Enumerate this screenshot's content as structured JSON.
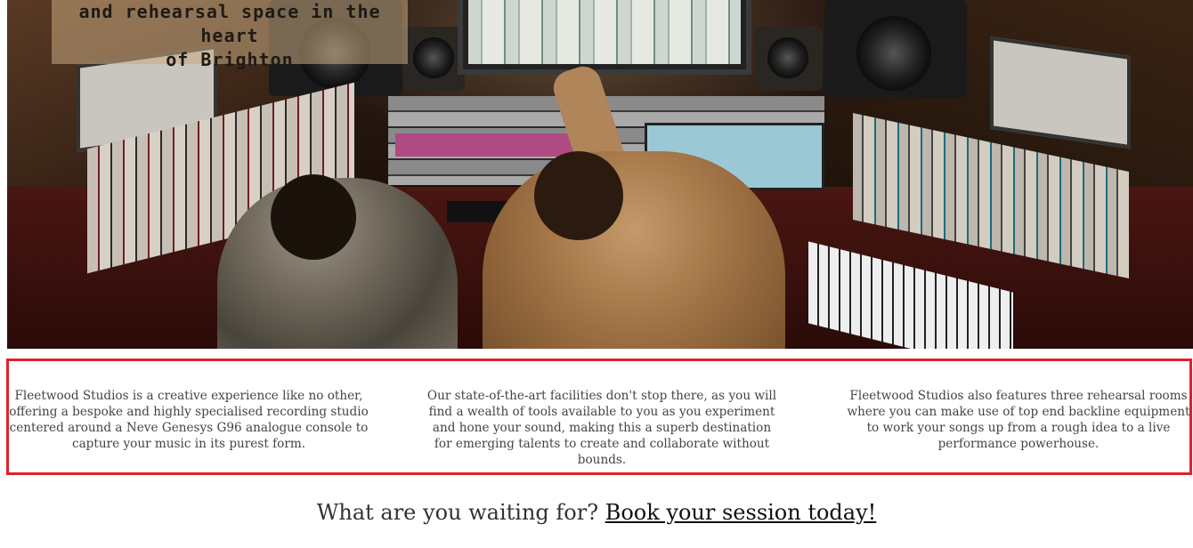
{
  "hero": {
    "caption_lines": [
      "and rehearsal space in the heart",
      "of Brighton"
    ]
  },
  "info": {
    "columns": [
      "Fleetwood Studios is a creative experience like no other, offering a bespoke and highly specialised recording studio centered around a Neve Genesys G96 analogue console to capture your music in its purest form.",
      "Our state-of-the-art facilities don't stop there, as you will find a wealth of tools available to you as you experiment and hone your sound, making this a superb destination for emerging talents to create and collaborate without bounds.",
      "Fleetwood Studios also features three rehearsal rooms where you can make use of top end backline equipment to work your songs up from a rough idea to a live performance powerhouse."
    ],
    "border_color": "#e1202a"
  },
  "cta": {
    "prompt": "What are you waiting for?",
    "link_label": "Book your session today!"
  }
}
